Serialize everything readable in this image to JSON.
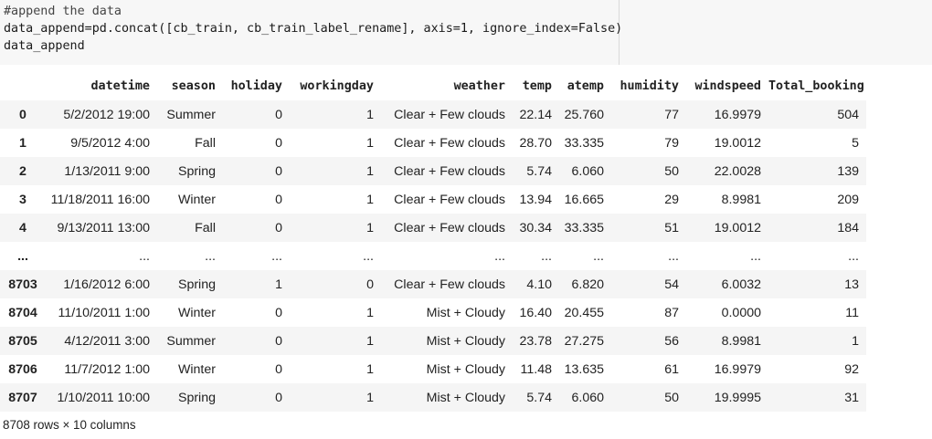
{
  "code": {
    "lines": [
      "#append the data",
      "data_append=pd.concat([cb_train, cb_train_label_rename], axis=1, ignore_index=False)",
      "data_append"
    ]
  },
  "table": {
    "columns": [
      "",
      "datetime",
      "season",
      "holiday",
      "workingday",
      "weather",
      "temp",
      "atemp",
      "humidity",
      "windspeed",
      "Total_booking"
    ],
    "rows": [
      [
        "0",
        "5/2/2012 19:00",
        "Summer",
        "0",
        "1",
        "Clear + Few clouds",
        "22.14",
        "25.760",
        "77",
        "16.9979",
        "504"
      ],
      [
        "1",
        "9/5/2012 4:00",
        "Fall",
        "0",
        "1",
        "Clear + Few clouds",
        "28.70",
        "33.335",
        "79",
        "19.0012",
        "5"
      ],
      [
        "2",
        "1/13/2011 9:00",
        "Spring",
        "0",
        "1",
        "Clear + Few clouds",
        "5.74",
        "6.060",
        "50",
        "22.0028",
        "139"
      ],
      [
        "3",
        "11/18/2011 16:00",
        "Winter",
        "0",
        "1",
        "Clear + Few clouds",
        "13.94",
        "16.665",
        "29",
        "8.9981",
        "209"
      ],
      [
        "4",
        "9/13/2011 13:00",
        "Fall",
        "0",
        "1",
        "Clear + Few clouds",
        "30.34",
        "33.335",
        "51",
        "19.0012",
        "184"
      ],
      [
        "...",
        "...",
        "...",
        "...",
        "...",
        "...",
        "...",
        "...",
        "...",
        "...",
        "..."
      ],
      [
        "8703",
        "1/16/2012 6:00",
        "Spring",
        "1",
        "0",
        "Clear + Few clouds",
        "4.10",
        "6.820",
        "54",
        "6.0032",
        "13"
      ],
      [
        "8704",
        "11/10/2011 1:00",
        "Winter",
        "0",
        "1",
        "Mist + Cloudy",
        "16.40",
        "20.455",
        "87",
        "0.0000",
        "11"
      ],
      [
        "8705",
        "4/12/2011 3:00",
        "Summer",
        "0",
        "1",
        "Mist + Cloudy",
        "23.78",
        "27.275",
        "56",
        "8.9981",
        "1"
      ],
      [
        "8706",
        "11/7/2012 1:00",
        "Winter",
        "0",
        "1",
        "Mist + Cloudy",
        "11.48",
        "13.635",
        "61",
        "16.9979",
        "92"
      ],
      [
        "8707",
        "1/10/2011 10:00",
        "Spring",
        "0",
        "1",
        "Mist + Cloudy",
        "5.74",
        "6.060",
        "50",
        "19.9995",
        "31"
      ]
    ],
    "shape_text": "8708 rows × 10 columns"
  }
}
